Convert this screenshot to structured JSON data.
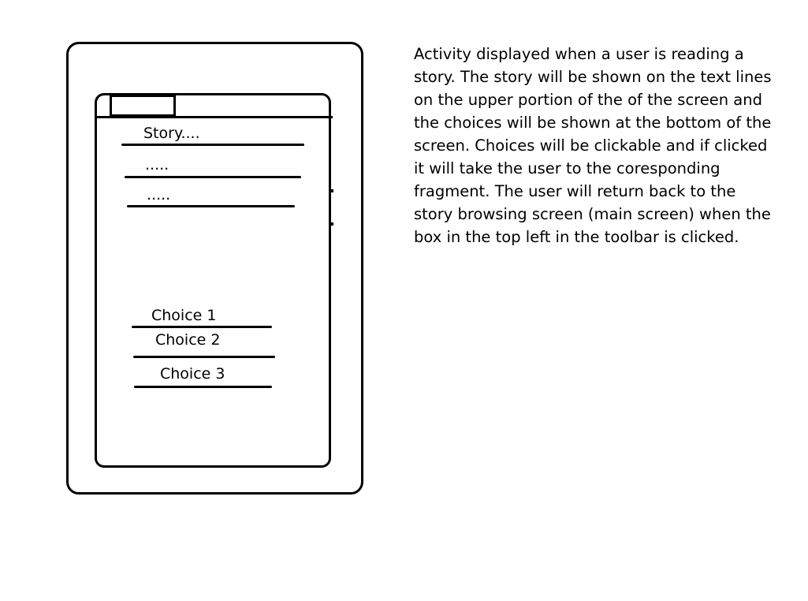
{
  "screen": {
    "story_lines": [
      "Story....",
      ".....",
      "....."
    ],
    "choices": [
      "Choice 1",
      "Choice 2",
      "Choice 3"
    ]
  },
  "description": "Activity displayed when a user is reading a story. The story will be shown on the text lines on the upper portion of the of the screen and the choices will be shown at the bottom of the screen. Choices will be clickable and if clicked it will take the user to the coresponding fragment. The user will return back to the story browsing screen (main screen) when the box in the top left in the toolbar is clicked."
}
